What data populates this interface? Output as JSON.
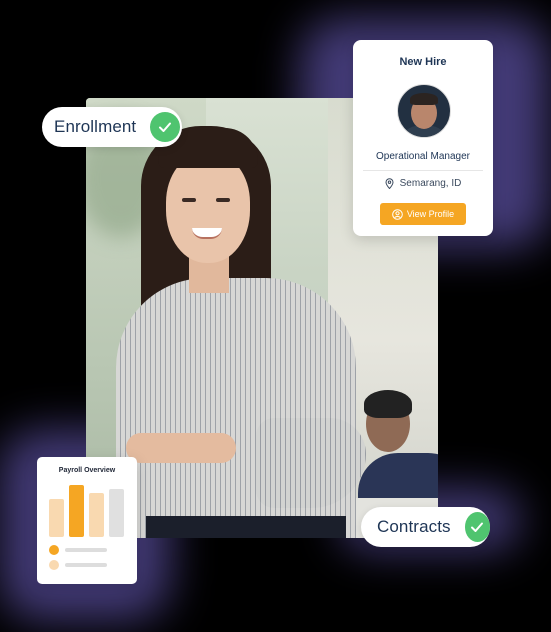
{
  "enrollment_pill": {
    "label": "Enrollment",
    "icon": "check-icon"
  },
  "contracts_pill": {
    "label": "Contracts",
    "icon": "check-icon"
  },
  "new_hire_card": {
    "title": "New Hire",
    "role": "Operational Manager",
    "location": "Semarang, ID",
    "button_label": "View Profile",
    "location_icon": "location-pin-icon",
    "button_icon": "user-circle-icon"
  },
  "payroll_card": {
    "title": "Payroll Overview",
    "bars": [
      {
        "level": 0.5,
        "color": "#f9d9b0"
      },
      {
        "level": 0.68,
        "color": "#f5a623"
      },
      {
        "level": 0.58,
        "color": "#f9d9b0"
      },
      {
        "level": 0.63,
        "color": "#e0e0e0"
      }
    ],
    "legend": [
      {
        "color": "#f5a623"
      },
      {
        "color": "#f9d9b0"
      }
    ]
  },
  "colors": {
    "accent": "#f5a623",
    "success": "#4fc46f",
    "text": "#1e3555"
  }
}
